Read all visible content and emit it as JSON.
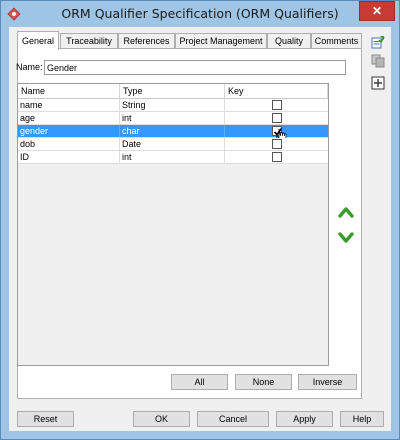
{
  "window": {
    "title": "ORM Qualifier Specification (ORM Qualifiers)",
    "close_glyph": "✕"
  },
  "tabs": [
    {
      "label": "General",
      "active": true
    },
    {
      "label": "Traceability"
    },
    {
      "label": "References"
    },
    {
      "label": "Project Management"
    },
    {
      "label": "Quality"
    },
    {
      "label": "Comments"
    }
  ],
  "name_field": {
    "label": "Name:",
    "value": "Gender"
  },
  "table": {
    "headers": [
      "Name",
      "Type",
      "Key"
    ],
    "rows": [
      {
        "name": "name",
        "type": "String",
        "key": false
      },
      {
        "name": "age",
        "type": "int",
        "key": false
      },
      {
        "name": "gender",
        "type": "char",
        "key": true,
        "selected": true
      },
      {
        "name": "dob",
        "type": "Date",
        "key": false
      },
      {
        "name": "ID",
        "type": "int",
        "key": false
      }
    ]
  },
  "list_buttons": {
    "all": "All",
    "none": "None",
    "inverse": "Inverse"
  },
  "footer": {
    "reset": "Reset",
    "ok": "OK",
    "cancel": "Cancel",
    "apply": "Apply",
    "help": "Help"
  },
  "colors": {
    "selection": "#3399ff",
    "arrow_green": "#3a9a2a",
    "close_red": "#c73b36"
  },
  "icons": [
    "app-icon",
    "move-up-icon",
    "move-down-icon",
    "new-spec-icon",
    "copy-icon",
    "add-icon",
    "checkmark-icon",
    "mouse-cursor-icon"
  ]
}
